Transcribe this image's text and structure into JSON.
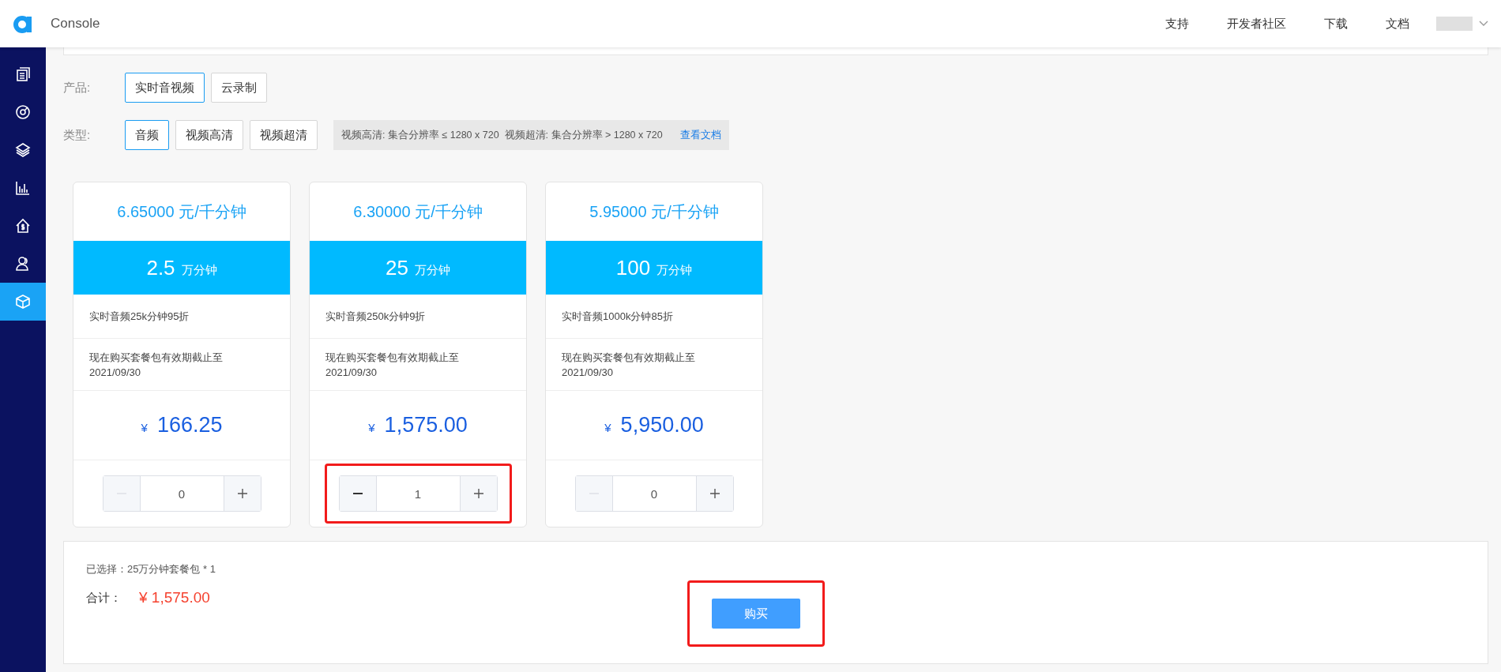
{
  "topbar": {
    "title": "Console",
    "nav": [
      "支持",
      "开发者社区",
      "下载",
      "文档"
    ]
  },
  "sidebar": {
    "items": [
      {
        "selected": false
      },
      {
        "selected": false
      },
      {
        "selected": false
      },
      {
        "selected": false
      },
      {
        "selected": false
      },
      {
        "selected": false
      },
      {
        "selected": true
      }
    ]
  },
  "filters": [
    {
      "label": "产品:",
      "options": [
        {
          "label": "实时音视频",
          "selected": true
        },
        {
          "label": "云录制",
          "selected": false
        }
      ]
    },
    {
      "label": "类型:",
      "options": [
        {
          "label": "音频",
          "selected": true
        },
        {
          "label": "视频高清",
          "selected": false
        },
        {
          "label": "视频超清",
          "selected": false
        }
      ],
      "note": "视频高清: 集合分辨率 ≤ 1280 x 720  视频超清: 集合分辨率 > 1280 x 720",
      "link": "查看文档"
    }
  ],
  "packages": [
    {
      "unit_price": "6.65000 元/千分钟",
      "amount": "2.5",
      "amount_unit": "万分钟",
      "discount": "实时音频25k分钟95折",
      "validity": "现在购买套餐包有效期截止至",
      "date": "2021/09/30",
      "currency": "¥",
      "price": "166.25",
      "quantity": "0",
      "minus_disabled": true,
      "highlighted": false
    },
    {
      "unit_price": "6.30000 元/千分钟",
      "amount": "25",
      "amount_unit": "万分钟",
      "discount": "实时音频250k分钟9折",
      "validity": "现在购买套餐包有效期截止至",
      "date": "2021/09/30",
      "currency": "¥",
      "price": "1,575.00",
      "quantity": "1",
      "minus_disabled": false,
      "highlighted": true
    },
    {
      "unit_price": "5.95000 元/千分钟",
      "amount": "100",
      "amount_unit": "万分钟",
      "discount": "实时音频1000k分钟85折",
      "validity": "现在购买套餐包有效期截止至",
      "date": "2021/09/30",
      "currency": "¥",
      "price": "5,950.00",
      "quantity": "0",
      "minus_disabled": true,
      "highlighted": false
    }
  ],
  "summary": {
    "selection": "已选择：25万分钟套餐包 * 1",
    "total_label": "合计：",
    "total": "¥ 1,575.00",
    "buy_button": "购买",
    "buy_highlighted": true
  }
}
